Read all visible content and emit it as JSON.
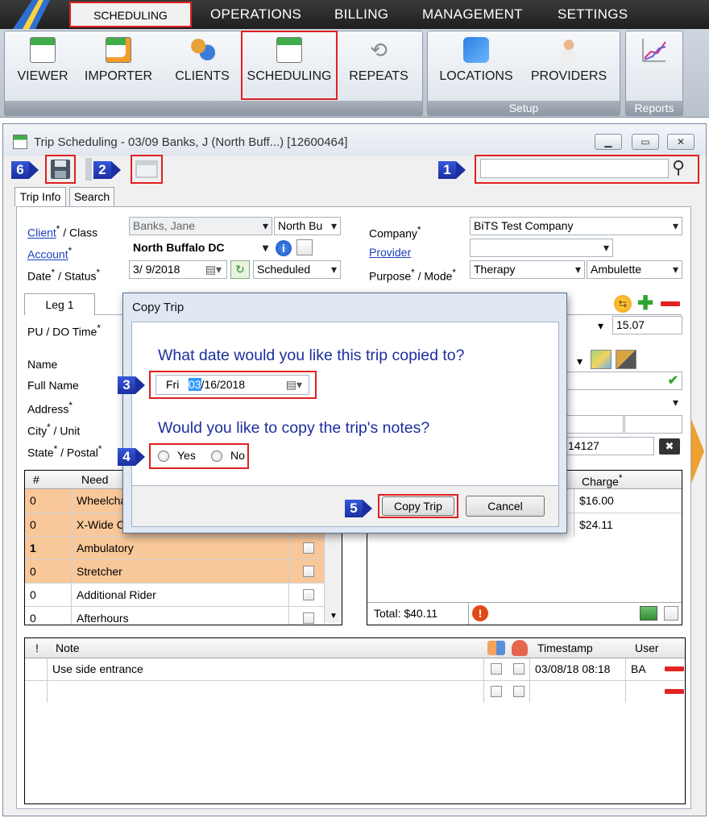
{
  "top_menu": {
    "scheduling": "SCHEDULING",
    "operations": "OPERATIONS",
    "billing": "BILLING",
    "management": "MANAGEMENT",
    "settings": "SETTINGS"
  },
  "ribbon": {
    "viewer": "VIEWER",
    "importer": "IMPORTER",
    "clients": "CLIENTS",
    "scheduling": "SCHEDULING",
    "repeats": "REPEATS",
    "locations": "LOCATIONS",
    "providers": "PROVIDERS",
    "setup_group": "Setup",
    "reports_group": "Reports"
  },
  "window": {
    "title": "Trip Scheduling - 03/09 Banks, J (North Buff...) [12600464]"
  },
  "badges": {
    "b1": "1",
    "b2": "2",
    "b3": "3",
    "b4": "4",
    "b5": "5",
    "b6": "6"
  },
  "search": {
    "value": ""
  },
  "tabs": {
    "trip_info": "Trip Info",
    "search": "Search"
  },
  "form": {
    "client_link": "Client",
    "class_label": " / Class",
    "client_value": "Banks, Jane",
    "class_value": "North Bu",
    "account_link": "Account",
    "account_value": "North Buffalo DC",
    "date_label": "Date",
    "status_label": " / Status",
    "date_value": "3/ 9/2018",
    "status_value": "Scheduled",
    "company_label": "Company",
    "company_value": "BiTS Test Company",
    "provider_link": "Provider",
    "provider_value": "",
    "purpose_label": "Purpose",
    "mode_label": " / Mode",
    "purpose_value": "Therapy",
    "mode_value": "Ambulette",
    "required_mark": "*"
  },
  "leg": {
    "tab": "Leg 1",
    "pu_do_time": "PU / DO Time",
    "distance_value": "15.07",
    "name": "Name",
    "full_name": "Full Name",
    "address": "Address",
    "city": "City",
    "unit": " / Unit",
    "state": "State",
    "postal": " / Postal",
    "postal_value": "14127"
  },
  "needs": {
    "col_num": "#",
    "col_need": "Need",
    "rows": [
      {
        "count": "0",
        "need": "Wheelchair"
      },
      {
        "count": "0",
        "need": "X-Wide Chair"
      },
      {
        "count": "1",
        "need": "Ambulatory"
      },
      {
        "count": "0",
        "need": "Stretcher"
      },
      {
        "count": "0",
        "need": "Additional Rider"
      },
      {
        "count": "0",
        "need": "Afterhours"
      }
    ]
  },
  "charges": {
    "col_charge": "Charge",
    "values": [
      "$16.00",
      "$24.11"
    ],
    "total": "Total: $40.11"
  },
  "notes": {
    "col_flag": "!",
    "col_note": "Note",
    "col_timestamp": "Timestamp",
    "col_user": "User",
    "rows": [
      {
        "note": "Use side entrance",
        "timestamp": "03/08/18 08:18",
        "user": "BA"
      },
      {
        "note": "",
        "timestamp": "",
        "user": ""
      }
    ]
  },
  "dialog": {
    "title": "Copy Trip",
    "question_date": "What date would you like this trip copied to?",
    "date_day": "Fri",
    "date_month": "03",
    "date_rest": "/16/2018",
    "question_notes": "Would you like to copy the trip's notes?",
    "yes": "Yes",
    "no": "No",
    "copy_button": "Copy Trip",
    "cancel_button": "Cancel"
  },
  "colors": {
    "accent_red": "#e02020",
    "badge_blue": "#1b2fa0",
    "question_blue": "#1c2f9d",
    "need_row_orange": "#f9c89a"
  }
}
